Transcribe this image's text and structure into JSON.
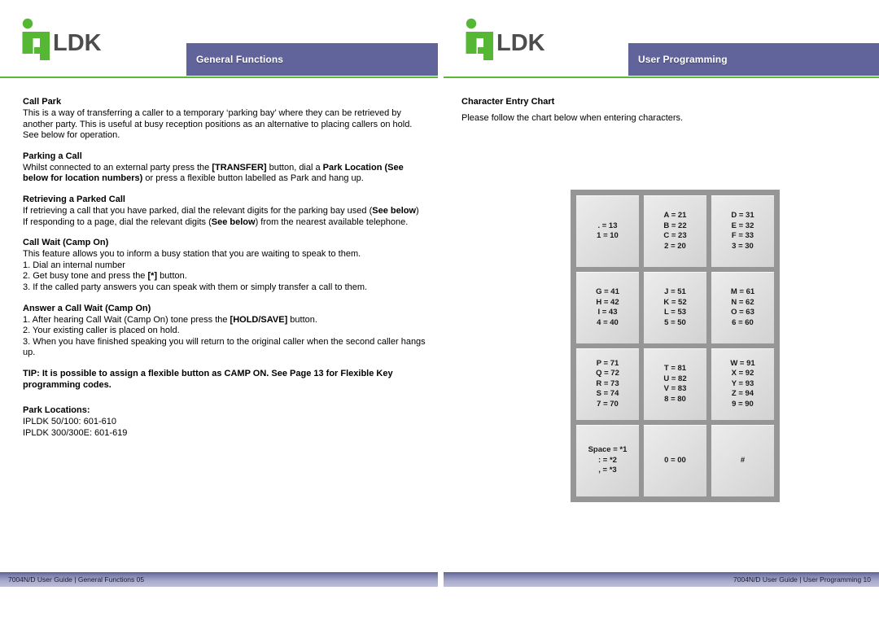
{
  "brand": {
    "logo_name": "ipldk-logo",
    "logo_ip": "ip",
    "logo_ldk": "LDK",
    "green": "#5cb832",
    "header_purple": "#61649a"
  },
  "left_page": {
    "header_title": "General Functions",
    "footer_text": "7004N/D User Guide | General Functions 05",
    "sections": [
      {
        "heading": "Call Park",
        "body_html": "This is a way of transferring a caller to a temporary ‘parking bay’ where they can be retrieved by another party. This is useful at busy reception positions as an alternative to placing callers on hold. See below for operation."
      },
      {
        "heading": "Parking a Call",
        "body_html": "Whilst connected to an external party press the <b>[TRANSFER]</b> button, dial a <b>Park Location (See below for location numbers)</b> or press a flexible button labelled as Park and hang up."
      },
      {
        "heading": "Retrieving a Parked Call",
        "body_html": "If retrieving a call that you have parked, dial the relevant digits for the parking bay used (<b>See below</b>)<br>If responding to a page, dial the relevant digits (<b>See below</b>) from the nearest available telephone."
      },
      {
        "heading": "Call Wait (Camp On)",
        "body_html": "This feature allows you to inform a busy station that you are waiting to speak to them.<br>1. Dial an internal number<br>2. Get busy tone and press the <b>[*]</b> button.<br>3. If the called party answers you can speak with them or simply transfer a call to them."
      },
      {
        "heading": "Answer a Call Wait (Camp On)",
        "body_html": "1. After hearing Call Wait (Camp On) tone press the <b>[HOLD/SAVE]</b> button.<br>2. Your existing caller is placed on hold.<br>3. When you have finished speaking you will return to the original caller when the second caller hangs up."
      }
    ],
    "tip_text": "TIP: It is possible to assign a flexible button as CAMP ON. See Page 13 for Flexible Key programming codes.",
    "park_locations": {
      "heading": "Park Locations:",
      "lines": [
        "IPLDK 50/100: 601-610",
        "IPLDK 300/300E: 601-619"
      ]
    }
  },
  "right_page": {
    "header_title": "User Programming",
    "footer_text": "7004N/D User Guide | User Programming 10",
    "chart_heading": "Character Entry Chart",
    "chart_intro": "Please follow the chart below when entering characters.",
    "chart_data": {
      "type": "table",
      "title": "Character Entry Chart",
      "rows": 4,
      "columns": 3,
      "cells": [
        {
          "lines": [
            ". = 13",
            "1 = 10"
          ]
        },
        {
          "lines": [
            "A = 21",
            "B = 22",
            "C = 23",
            "2 = 20"
          ]
        },
        {
          "lines": [
            "D = 31",
            "E = 32",
            "F = 33",
            "3 = 30"
          ]
        },
        {
          "lines": [
            "G = 41",
            "H = 42",
            "I = 43",
            "4 = 40"
          ]
        },
        {
          "lines": [
            "J = 51",
            "K = 52",
            "L = 53",
            "5 = 50"
          ]
        },
        {
          "lines": [
            "M = 61",
            "N = 62",
            "O = 63",
            "6 = 60"
          ]
        },
        {
          "lines": [
            "P = 71",
            "Q = 72",
            "R = 73",
            "S = 74",
            "7 = 70"
          ]
        },
        {
          "lines": [
            "T = 81",
            "U = 82",
            "V = 83",
            "8 = 80"
          ]
        },
        {
          "lines": [
            "W = 91",
            "X = 92",
            "Y = 93",
            "Z = 94",
            "9 = 90"
          ]
        },
        {
          "lines": [
            "Space = *1",
            ": = *2",
            ", = *3"
          ]
        },
        {
          "lines": [
            "0 = 00"
          ]
        },
        {
          "lines": [
            "#"
          ]
        }
      ]
    }
  }
}
